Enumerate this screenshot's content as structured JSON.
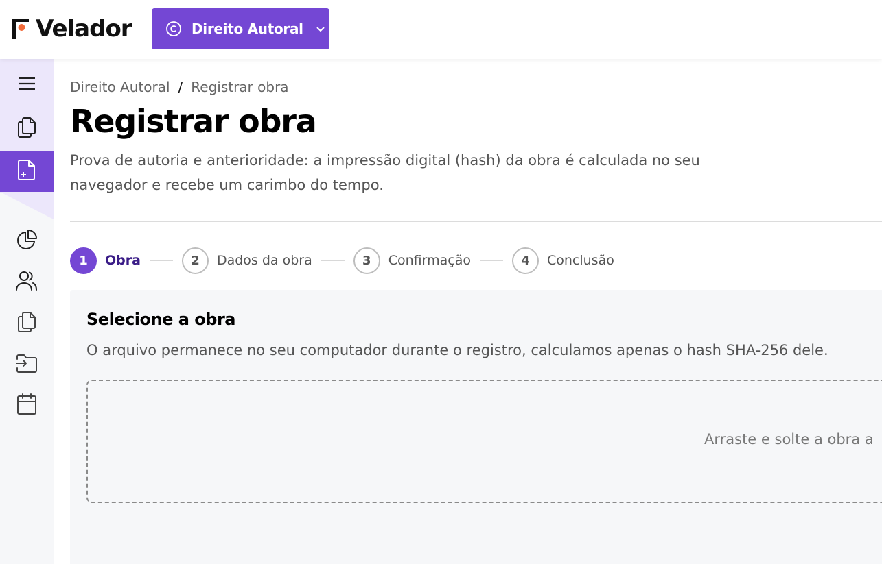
{
  "app": {
    "name": "Velador",
    "brand_color": "#7447d4",
    "logo_accent": "#f26b3a"
  },
  "header": {
    "context_switcher": {
      "label": "Direito Autoral",
      "icon": "copyright-icon",
      "chevron": "chevron-down-icon"
    }
  },
  "sidebar": {
    "items": [
      {
        "name": "menu",
        "icon": "hamburger-icon",
        "active": false
      },
      {
        "name": "documents",
        "icon": "copy-documents-icon",
        "active": false
      },
      {
        "name": "register-work",
        "icon": "file-plus-icon",
        "active": true
      },
      {
        "name": "reports",
        "icon": "pie-chart-icon",
        "active": false
      },
      {
        "name": "users",
        "icon": "users-icon",
        "active": false
      },
      {
        "name": "files",
        "icon": "copy-files-icon",
        "active": false
      },
      {
        "name": "import",
        "icon": "folder-import-icon",
        "active": false
      },
      {
        "name": "calendar",
        "icon": "calendar-icon",
        "active": false
      }
    ]
  },
  "breadcrumb": {
    "parent": "Direito Autoral",
    "separator": "/",
    "current": "Registrar obra"
  },
  "page": {
    "title": "Registrar obra",
    "description": "Prova de autoria e anterioridade: a impressão digital (hash) da obra é calculada no seu navegador e recebe um carimbo do tempo."
  },
  "stepper": {
    "steps": [
      {
        "number": "1",
        "label": "Obra",
        "state": "current"
      },
      {
        "number": "2",
        "label": "Dados da obra",
        "state": "upcoming"
      },
      {
        "number": "3",
        "label": "Confirmação",
        "state": "upcoming"
      },
      {
        "number": "4",
        "label": "Conclusão",
        "state": "upcoming"
      }
    ]
  },
  "card": {
    "title": "Selecione a obra",
    "description": "O arquivo permanece no seu computador durante o registro, calculamos apenas o hash SHA-256 dele.",
    "dropzone_text": "Arraste e solte a obra a"
  }
}
